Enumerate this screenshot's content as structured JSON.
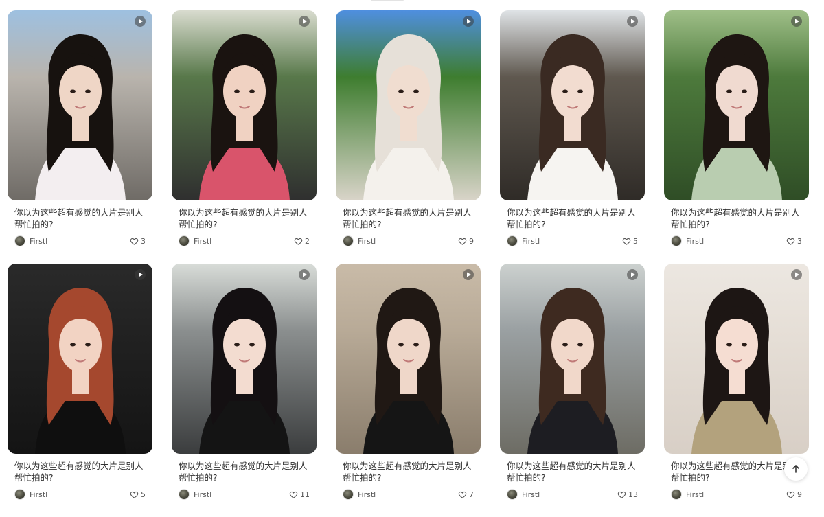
{
  "feed": {
    "cards": [
      {
        "title": "你以为这些超有感觉的大片是别人帮忙拍的?",
        "author": "Firstl",
        "likes": "3",
        "photo": {
          "bg1": "#b9b4ad",
          "bg2": "#6f6b66",
          "top": "#9ec0e0",
          "hair": "#17120f",
          "skin": "#efd6c6",
          "cloth": "#f3eef0"
        }
      },
      {
        "title": "你以为这些超有感觉的大片是别人帮忙拍的?",
        "author": "Firstl",
        "likes": "2",
        "photo": {
          "bg1": "#58784a",
          "bg2": "#2f2f2f",
          "top": "#d9dccf",
          "hair": "#1a1310",
          "skin": "#f0d2c2",
          "cloth": "#d9546b"
        }
      },
      {
        "title": "你以为这些超有感觉的大片是别人帮忙拍的?",
        "author": "Firstl",
        "likes": "9",
        "photo": {
          "bg1": "#3e7d2f",
          "bg2": "#d9d4c9",
          "top": "#4f8fdf",
          "hair": "#e6e0d8",
          "skin": "#f0ddd0",
          "cloth": "#f4f1ec"
        }
      },
      {
        "title": "你以为这些超有感觉的大片是别人帮忙拍的?",
        "author": "Firstl",
        "likes": "5",
        "photo": {
          "bg1": "#5f584f",
          "bg2": "#2f2b27",
          "top": "#dfe3e6",
          "hair": "#3a2a22",
          "skin": "#f2dcd0",
          "cloth": "#f6f4f1"
        }
      },
      {
        "title": "你以为这些超有感觉的大片是别人帮忙拍的?",
        "author": "Firstl",
        "likes": "3",
        "photo": {
          "bg1": "#4d7a3c",
          "bg2": "#2f4d26",
          "top": "#9fbf88",
          "hair": "#1e1612",
          "skin": "#f0dad0",
          "cloth": "#b9cdb0"
        }
      },
      {
        "title": "你以为这些超有感觉的大片是别人帮忙拍的?",
        "author": "Firstl",
        "likes": "5",
        "photo": {
          "bg1": "#222222",
          "bg2": "#141414",
          "top": "#2a2a2a",
          "hair": "#a5482e",
          "skin": "#f2d3c3",
          "cloth": "#0f0f0f"
        }
      },
      {
        "title": "你以为这些超有感觉的大片是别人帮忙拍的?",
        "author": "Firstl",
        "likes": "11",
        "photo": {
          "bg1": "#8b8f8f",
          "bg2": "#3b3d3e",
          "top": "#d8dcd8",
          "hair": "#141012",
          "skin": "#f3dcd0",
          "cloth": "#141414"
        }
      },
      {
        "title": "你以为这些超有感觉的大片是别人帮忙拍的?",
        "author": "Firstl",
        "likes": "7",
        "photo": {
          "bg1": "#b8aa97",
          "bg2": "#8a7d6c",
          "top": "#c9bba8",
          "hair": "#201814",
          "skin": "#efd7c9",
          "cloth": "#151515"
        }
      },
      {
        "title": "你以为这些超有感觉的大片是别人帮忙拍的?",
        "author": "Firstl",
        "likes": "13",
        "photo": {
          "bg1": "#9aa0a2",
          "bg2": "#6d6c64",
          "top": "#ccd1cf",
          "hair": "#3e2a20",
          "skin": "#f1d8ca",
          "cloth": "#1d1d22"
        }
      },
      {
        "title": "你以为这些超有感觉的大片是别人帮忙拍的?",
        "author": "Firstl",
        "likes": "9",
        "photo": {
          "bg1": "#e6dfd7",
          "bg2": "#d8cfc6",
          "top": "#ece7e1",
          "hair": "#1d1614",
          "skin": "#f5ddd2",
          "cloth": "#b3a27d"
        }
      }
    ]
  },
  "icons": {
    "video": "play-icon",
    "like": "heart-icon",
    "back_to_top": "arrow-up-icon"
  }
}
